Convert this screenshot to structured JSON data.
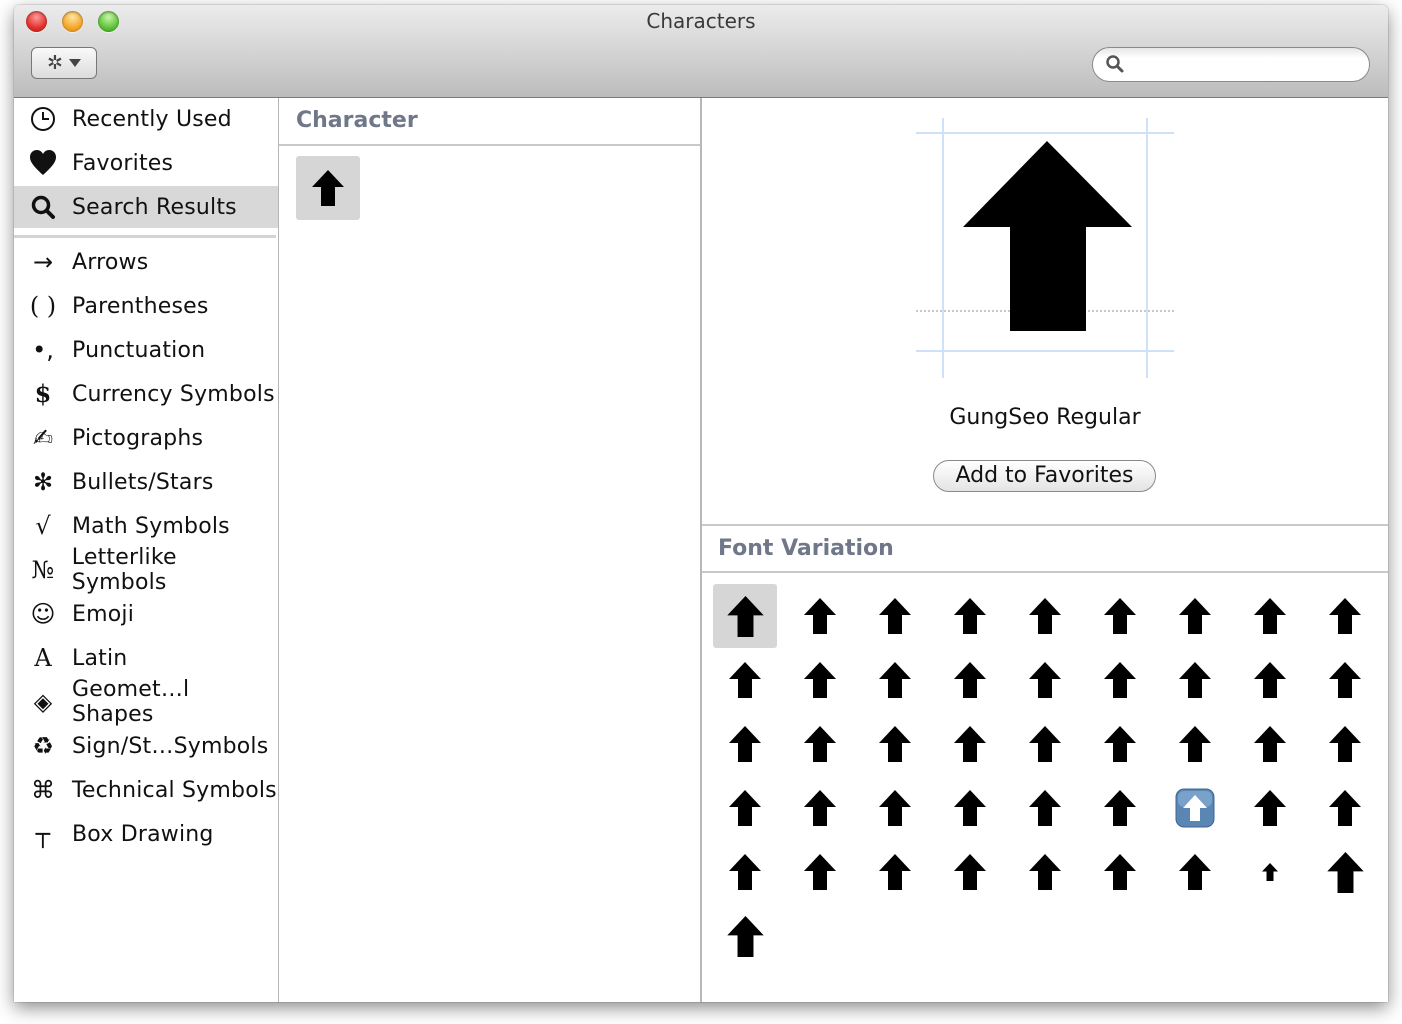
{
  "window": {
    "title": "Characters",
    "action_menu_icon": "gear-icon",
    "search": {
      "value": "",
      "placeholder": ""
    }
  },
  "sidebar": {
    "items": [
      {
        "label": "Recently Used",
        "icon": "clock-icon",
        "glyph": "◷",
        "selected": false
      },
      {
        "label": "Favorites",
        "icon": "heart-icon",
        "glyph": "♥",
        "selected": false
      },
      {
        "label": "Search Results",
        "icon": "search-icon",
        "glyph": "",
        "selected": true
      }
    ],
    "categories": [
      {
        "label": "Arrows",
        "icon": "arrow-right-icon",
        "glyph": "→"
      },
      {
        "label": "Parentheses",
        "icon": "parentheses-icon",
        "glyph": "( )"
      },
      {
        "label": "Punctuation",
        "icon": "punctuation-icon",
        "glyph": "•,"
      },
      {
        "label": "Currency Symbols",
        "icon": "dollar-icon",
        "glyph": "$"
      },
      {
        "label": "Pictographs",
        "icon": "writing-hand-icon",
        "glyph": "✍"
      },
      {
        "label": "Bullets/Stars",
        "icon": "asterisk-icon",
        "glyph": "✻"
      },
      {
        "label": "Math Symbols",
        "icon": "square-root-icon",
        "glyph": "√"
      },
      {
        "label": "Letterlike Symbols",
        "icon": "numero-icon",
        "glyph": "№"
      },
      {
        "label": "Emoji",
        "icon": "smiley-icon",
        "glyph": "☺"
      },
      {
        "label": "Latin",
        "icon": "letter-a-icon",
        "glyph": "A"
      },
      {
        "label": "Geomet…l Shapes",
        "icon": "diamond-icon",
        "glyph": "◈"
      },
      {
        "label": "Sign/St…Symbols",
        "icon": "recycle-icon",
        "glyph": "♻"
      },
      {
        "label": "Technical Symbols",
        "icon": "command-icon",
        "glyph": "⌘"
      },
      {
        "label": "Box Drawing",
        "icon": "box-drawing-icon",
        "glyph": "┬"
      }
    ]
  },
  "character_pane": {
    "header": "Character",
    "results": [
      {
        "char": "⬆",
        "name": "upwards-black-arrow",
        "selected": true
      }
    ]
  },
  "detail": {
    "font_name": "GungSeo Regular",
    "add_favorites_label": "Add to Favorites"
  },
  "font_variation": {
    "header": "Font Variation",
    "count": 46,
    "selected_index": 0,
    "emoji_index": 33,
    "small_index": 43,
    "large_indices": [
      0,
      44,
      45
    ]
  }
}
